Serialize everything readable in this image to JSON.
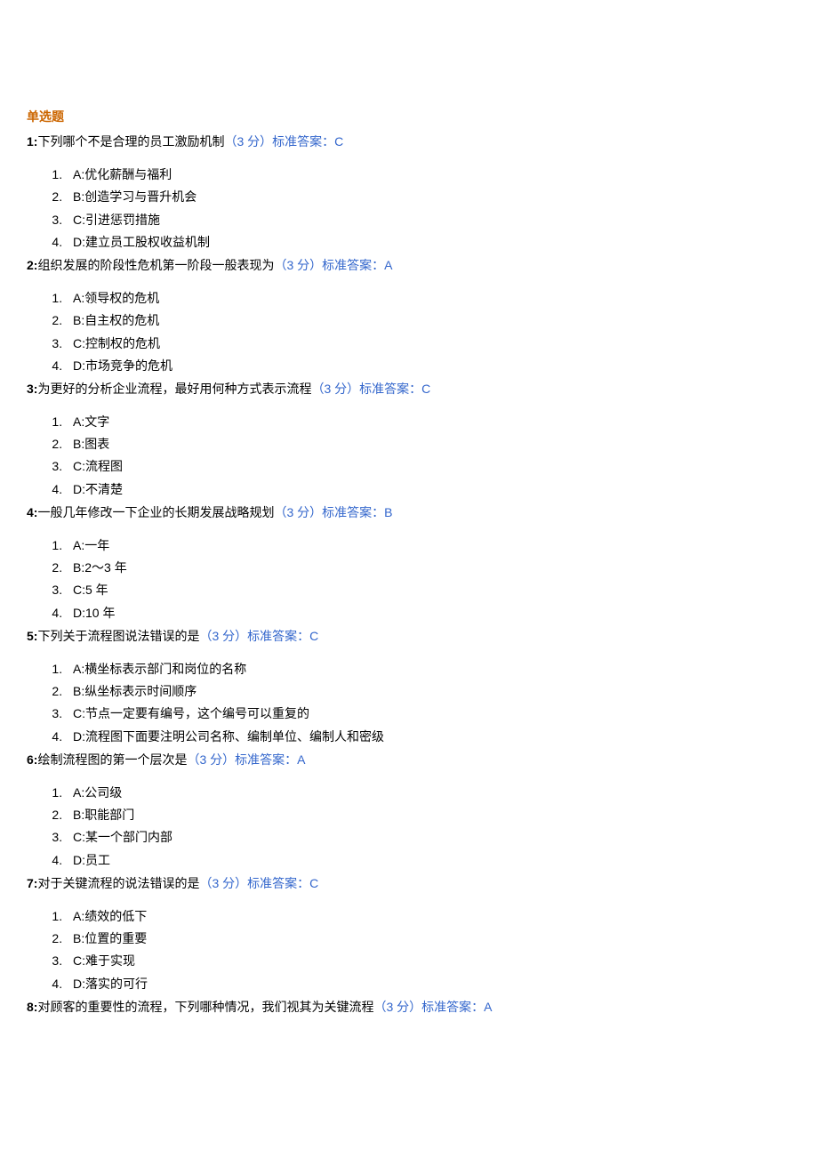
{
  "section_title": "单选题",
  "questions": [
    {
      "num": "1:",
      "stem": "下列哪个不是合理的员工激励机制",
      "points": "（3 分）",
      "ans_label": "标准答案：",
      "ans_value": "C",
      "choices": [
        "A:优化薪酬与福利",
        "B:创造学习与晋升机会",
        "C:引进惩罚措施",
        "D:建立员工股权收益机制"
      ]
    },
    {
      "num": "2:",
      "stem": "组织发展的阶段性危机第一阶段一般表现为",
      "points": "（3 分）",
      "ans_label": "标准答案：",
      "ans_value": "A",
      "choices": [
        "A:领导权的危机",
        "B:自主权的危机",
        "C:控制权的危机",
        "D:市场竞争的危机"
      ]
    },
    {
      "num": "3:",
      "stem": "为更好的分析企业流程，最好用何种方式表示流程",
      "points": "（3 分）",
      "ans_label": "标准答案：",
      "ans_value": "C",
      "choices": [
        "A:文字",
        "B:图表",
        "C:流程图",
        "D:不清楚"
      ]
    },
    {
      "num": "4:",
      "stem": "一般几年修改一下企业的长期发展战略规划",
      "points": "（3 分）",
      "ans_label": "标准答案：",
      "ans_value": "B",
      "choices": [
        "A:一年",
        "B:2～3 年",
        "C:5 年",
        "D:10 年"
      ]
    },
    {
      "num": "5:",
      "stem": "下列关于流程图说法错误的是",
      "points": "（3 分）",
      "ans_label": "标准答案：",
      "ans_value": "C",
      "choices": [
        "A:横坐标表示部门和岗位的名称",
        "B:纵坐标表示时间顺序",
        "C:节点一定要有编号，这个编号可以重复的",
        "D:流程图下面要注明公司名称、编制单位、编制人和密级"
      ]
    },
    {
      "num": "6:",
      "stem": "绘制流程图的第一个层次是",
      "points": "（3 分）",
      "ans_label": "标准答案：",
      "ans_value": "A",
      "choices": [
        "A:公司级",
        "B:职能部门",
        "C:某一个部门内部",
        "D:员工"
      ]
    },
    {
      "num": "7:",
      "stem": "对于关键流程的说法错误的是",
      "points": "（3 分）",
      "ans_label": "标准答案：",
      "ans_value": "C",
      "choices": [
        "A:绩效的低下",
        "B:位置的重要",
        "C:难于实现",
        "D:落实的可行"
      ]
    },
    {
      "num": "8:",
      "stem": "对顾客的重要性的流程，下列哪种情况，我们视其为关键流程",
      "points": "（3 分）",
      "ans_label": "标准答案：",
      "ans_value": "A",
      "choices": []
    }
  ]
}
